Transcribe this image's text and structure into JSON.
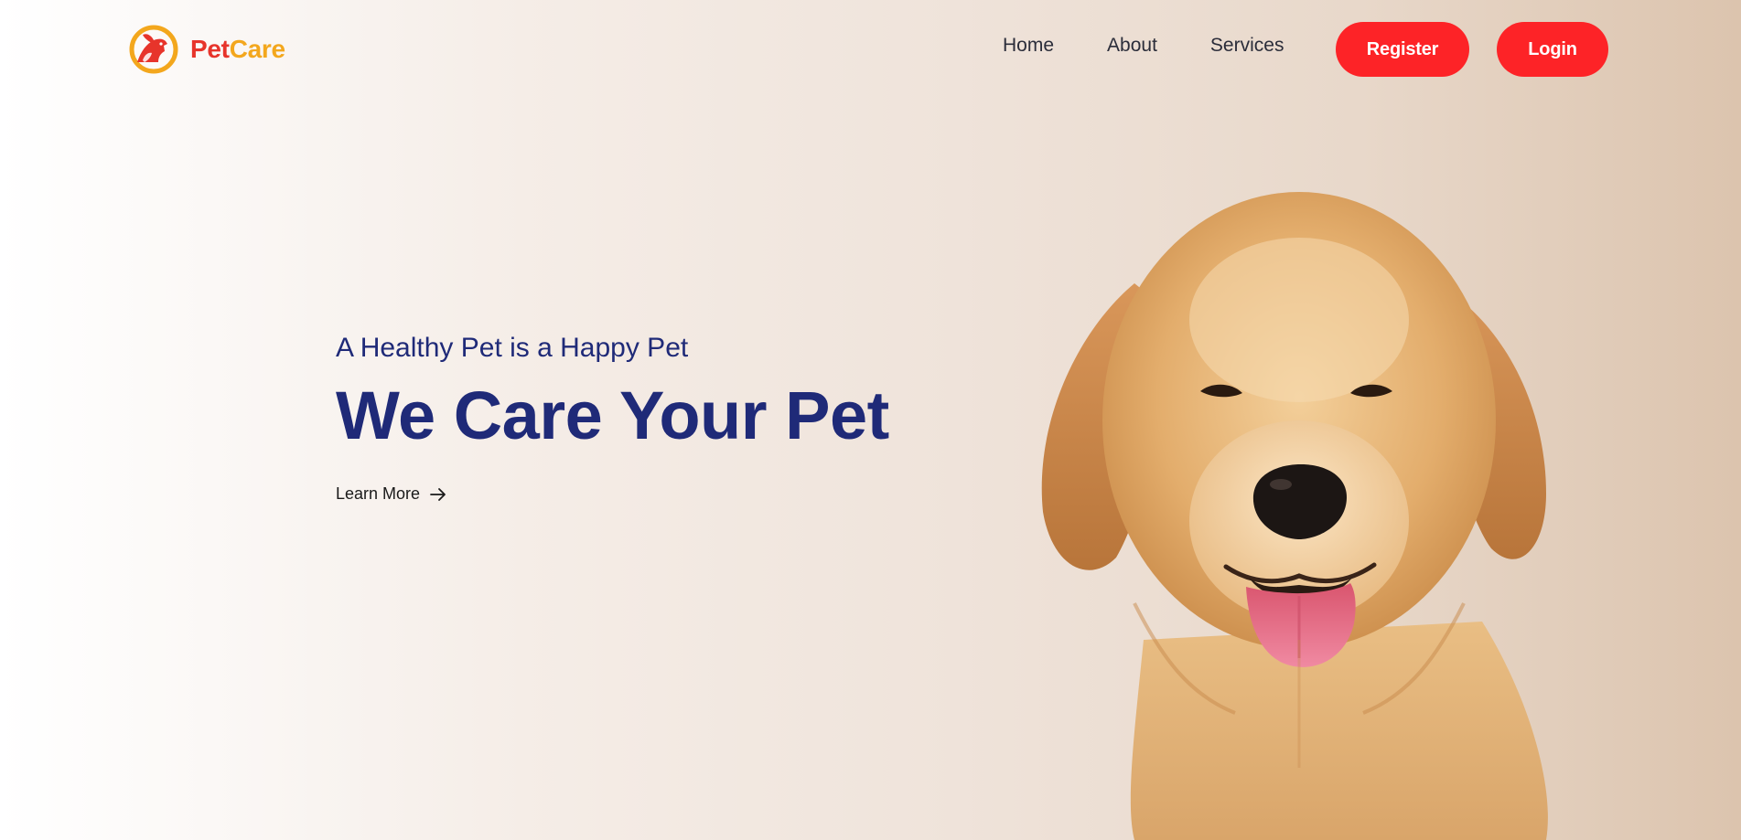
{
  "brand": {
    "name_part1": "Pet",
    "name_part2": "Care",
    "logo_icon": "pet-logo-icon"
  },
  "nav": {
    "links": [
      {
        "label": "Home"
      },
      {
        "label": "About"
      },
      {
        "label": "Services"
      }
    ],
    "register_label": "Register",
    "login_label": "Login"
  },
  "hero": {
    "tagline": "A Healthy Pet is a Happy Pet",
    "title": "We Care Your Pet",
    "cta_label": "Learn More",
    "cta_icon": "arrow-right-icon",
    "image": "golden-retriever-puppy"
  },
  "colors": {
    "brand_red": "#e7342b",
    "brand_orange": "#f3a71d",
    "button_red": "#fd2327",
    "heading_navy": "#1f2a78"
  }
}
